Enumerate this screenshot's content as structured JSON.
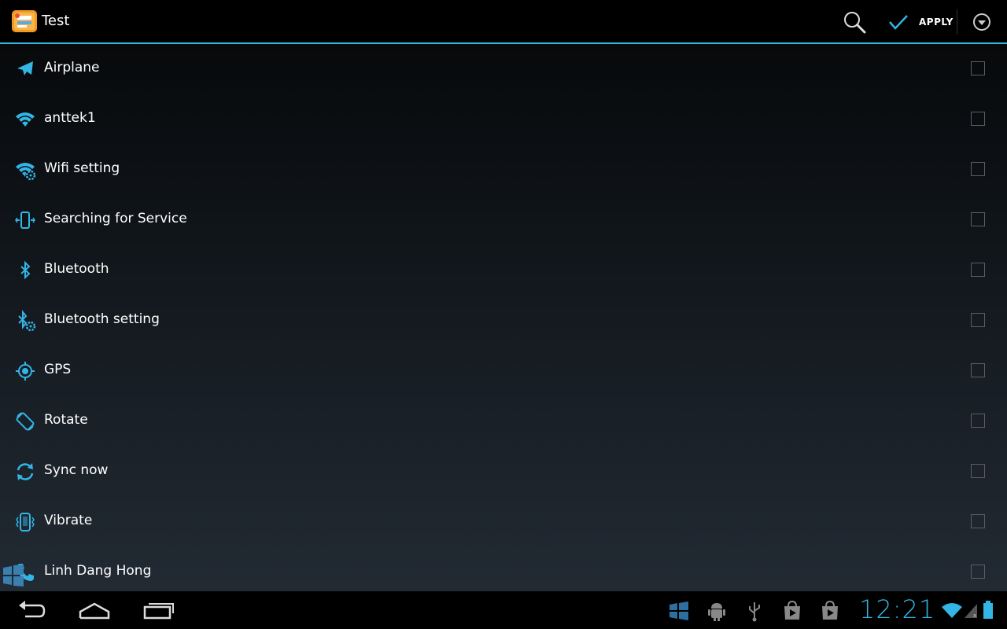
{
  "app": {
    "title": "Test"
  },
  "actionbar": {
    "search_icon": "search-icon",
    "apply_label": "APPLY",
    "apply_icon": "check-icon",
    "overflow_icon": "overflow-menu-icon"
  },
  "colors": {
    "accent": "#33b5e5",
    "background_top": "#07090b",
    "background_bottom": "#222a33"
  },
  "list": {
    "items": [
      {
        "label": "Airplane",
        "icon": "airplane-icon",
        "checked": false
      },
      {
        "label": "anttek1",
        "icon": "wifi-icon",
        "checked": false
      },
      {
        "label": "Wifi setting",
        "icon": "wifi-settings-icon",
        "checked": false
      },
      {
        "label": "Searching for Service",
        "icon": "phone-signal-icon",
        "checked": false
      },
      {
        "label": "Bluetooth",
        "icon": "bluetooth-icon",
        "checked": false
      },
      {
        "label": "Bluetooth setting",
        "icon": "bluetooth-settings-icon",
        "checked": false
      },
      {
        "label": "GPS",
        "icon": "gps-icon",
        "checked": false
      },
      {
        "label": "Rotate",
        "icon": "rotate-icon",
        "checked": false
      },
      {
        "label": "Sync now",
        "icon": "sync-icon",
        "checked": false
      },
      {
        "label": "Vibrate",
        "icon": "vibrate-icon",
        "checked": false
      },
      {
        "label": "Linh Dang Hong",
        "icon": "phone-call-icon",
        "checked": false
      }
    ]
  },
  "navbar": {
    "back_icon": "back-icon",
    "home_icon": "home-icon",
    "recents_icon": "recents-icon"
  },
  "status": {
    "time": "12:21",
    "icons": [
      "windows-icon",
      "android-debug-icon",
      "usb-icon",
      "play-store-icon",
      "play-store-icon",
      "wifi-signal-icon",
      "cell-signal-icon",
      "battery-icon"
    ]
  }
}
